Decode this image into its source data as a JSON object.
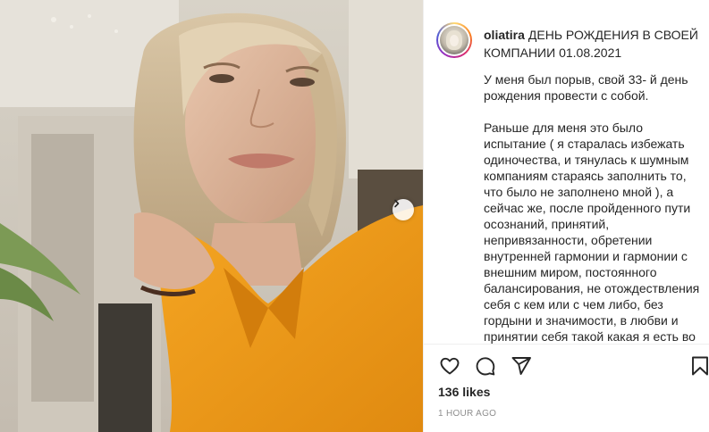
{
  "post": {
    "username": "oliatira",
    "title": "ДЕНЬ РОЖДЕНИЯ В СВОЕЙ КОМПАНИИ 01.08.2021",
    "paragraphs": [
      "У меня был порыв, свой 33- й день рождения провести с собой.",
      "Раньше для меня это было испытание ( я старалась избежать одиночества, и тянулась к шумным компаниям стараясь заполнить то, что было не заполнено мной ), а сейчас же, после пройденного пути осознаний, принятий, непривязанности, обретении внутренней гармонии и гармонии с внешним миром, постоянного балансирования, не отождествления себя с кем или с чем либо, без гордыни и значимости, в любви и принятии себя такой какая я есть во"
    ],
    "likes": "136 likes",
    "time": "1 HOUR AGO"
  },
  "icons": {
    "next": "chevron-right-icon",
    "like": "heart-icon",
    "comment": "comment-icon",
    "share": "paper-plane-icon",
    "save": "bookmark-icon"
  },
  "colors": {
    "text": "#262626",
    "muted": "#8e8e8e",
    "divider": "#efefef",
    "dress": "#f29a1a"
  }
}
